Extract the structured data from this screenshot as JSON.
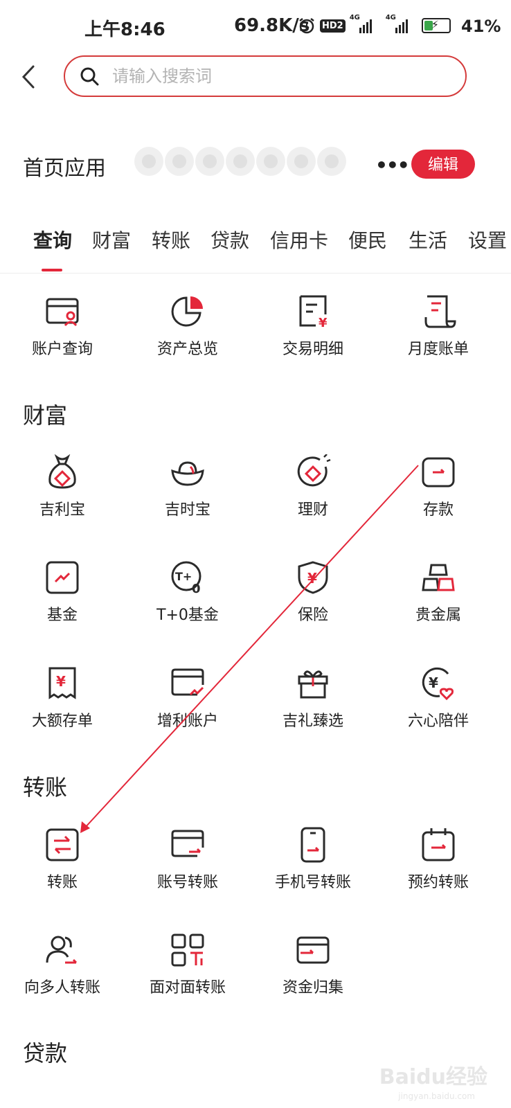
{
  "status_bar": {
    "time": "上午8:46",
    "speed": "69.8K/s",
    "hd_badge": "HD2",
    "net1": "4G",
    "net2": "4G",
    "battery": "41%",
    "battery_level": 0.41
  },
  "search": {
    "placeholder": "请输入搜索词"
  },
  "home_apps": {
    "title": "首页应用",
    "more": "•••",
    "edit_label": "编辑"
  },
  "tabs": [
    "查询",
    "财富",
    "转账",
    "贷款",
    "信用卡",
    "便民",
    "生活",
    "设置"
  ],
  "query_items": [
    "账户查询",
    "资产总览",
    "交易明细",
    "月度账单"
  ],
  "sections": {
    "wealth": {
      "title": "财富",
      "items": [
        "吉利宝",
        "吉时宝",
        "理财",
        "存款",
        "基金",
        "T+0基金",
        "保险",
        "贵金属",
        "大额存单",
        "增利账户",
        "吉礼臻选",
        "六心陪伴"
      ]
    },
    "transfer": {
      "title": "转账",
      "items": [
        "转账",
        "账号转账",
        "手机号转账",
        "预约转账",
        "向多人转账",
        "面对面转账",
        "资金归集"
      ]
    },
    "loan": {
      "title": "贷款"
    }
  },
  "watermark": {
    "text": "Baidu经验",
    "sub": "jingyan.baidu.com"
  },
  "colors": {
    "accent": "#e3273a",
    "icon_dark": "#2b2b2b"
  }
}
